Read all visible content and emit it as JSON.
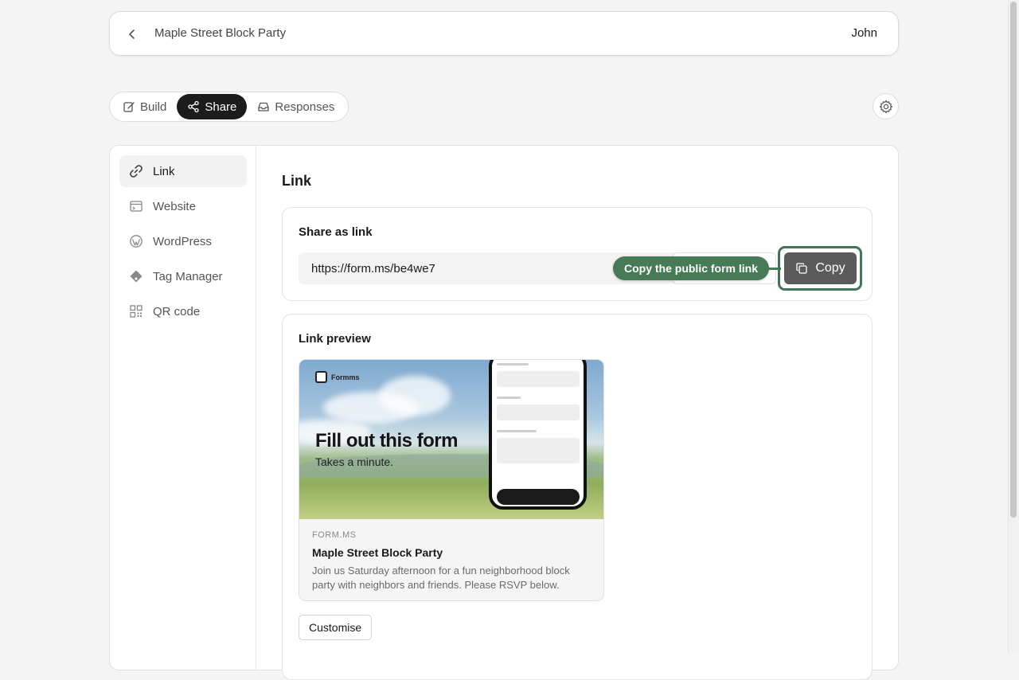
{
  "header": {
    "form_title": "Maple Street Block Party",
    "user_name": "John"
  },
  "tabs": [
    {
      "label": "Build",
      "icon": "edit-icon"
    },
    {
      "label": "Share",
      "icon": "share-icon",
      "active": true
    },
    {
      "label": "Responses",
      "icon": "inbox-icon"
    }
  ],
  "sidebar": {
    "items": [
      {
        "label": "Link",
        "icon": "link-icon",
        "active": true
      },
      {
        "label": "Website",
        "icon": "browser-icon"
      },
      {
        "label": "WordPress",
        "icon": "wordpress-icon"
      },
      {
        "label": "Tag Manager",
        "icon": "tag-manager-icon"
      },
      {
        "label": "QR code",
        "icon": "qr-code-icon"
      }
    ]
  },
  "main": {
    "section_title": "Link",
    "share_card": {
      "label": "Share as link",
      "url": "https://form.ms/be4we7",
      "copy_label": "Copy",
      "tooltip": "Copy the public form link"
    },
    "preview_card": {
      "label": "Link preview",
      "image": {
        "brand": "Formms",
        "headline": "Fill out this form",
        "subline": "Takes a minute."
      },
      "domain": "FORM.MS",
      "title": "Maple Street Block Party",
      "description": "Join us Saturday afternoon for a fun neighborhood block party with neighbors and friends. Please RSVP below.",
      "customise_label": "Customise"
    }
  },
  "colors": {
    "accent_green": "#477a57",
    "active_tab": "#1c1c1c",
    "copy_button": "#5b5b5b"
  }
}
